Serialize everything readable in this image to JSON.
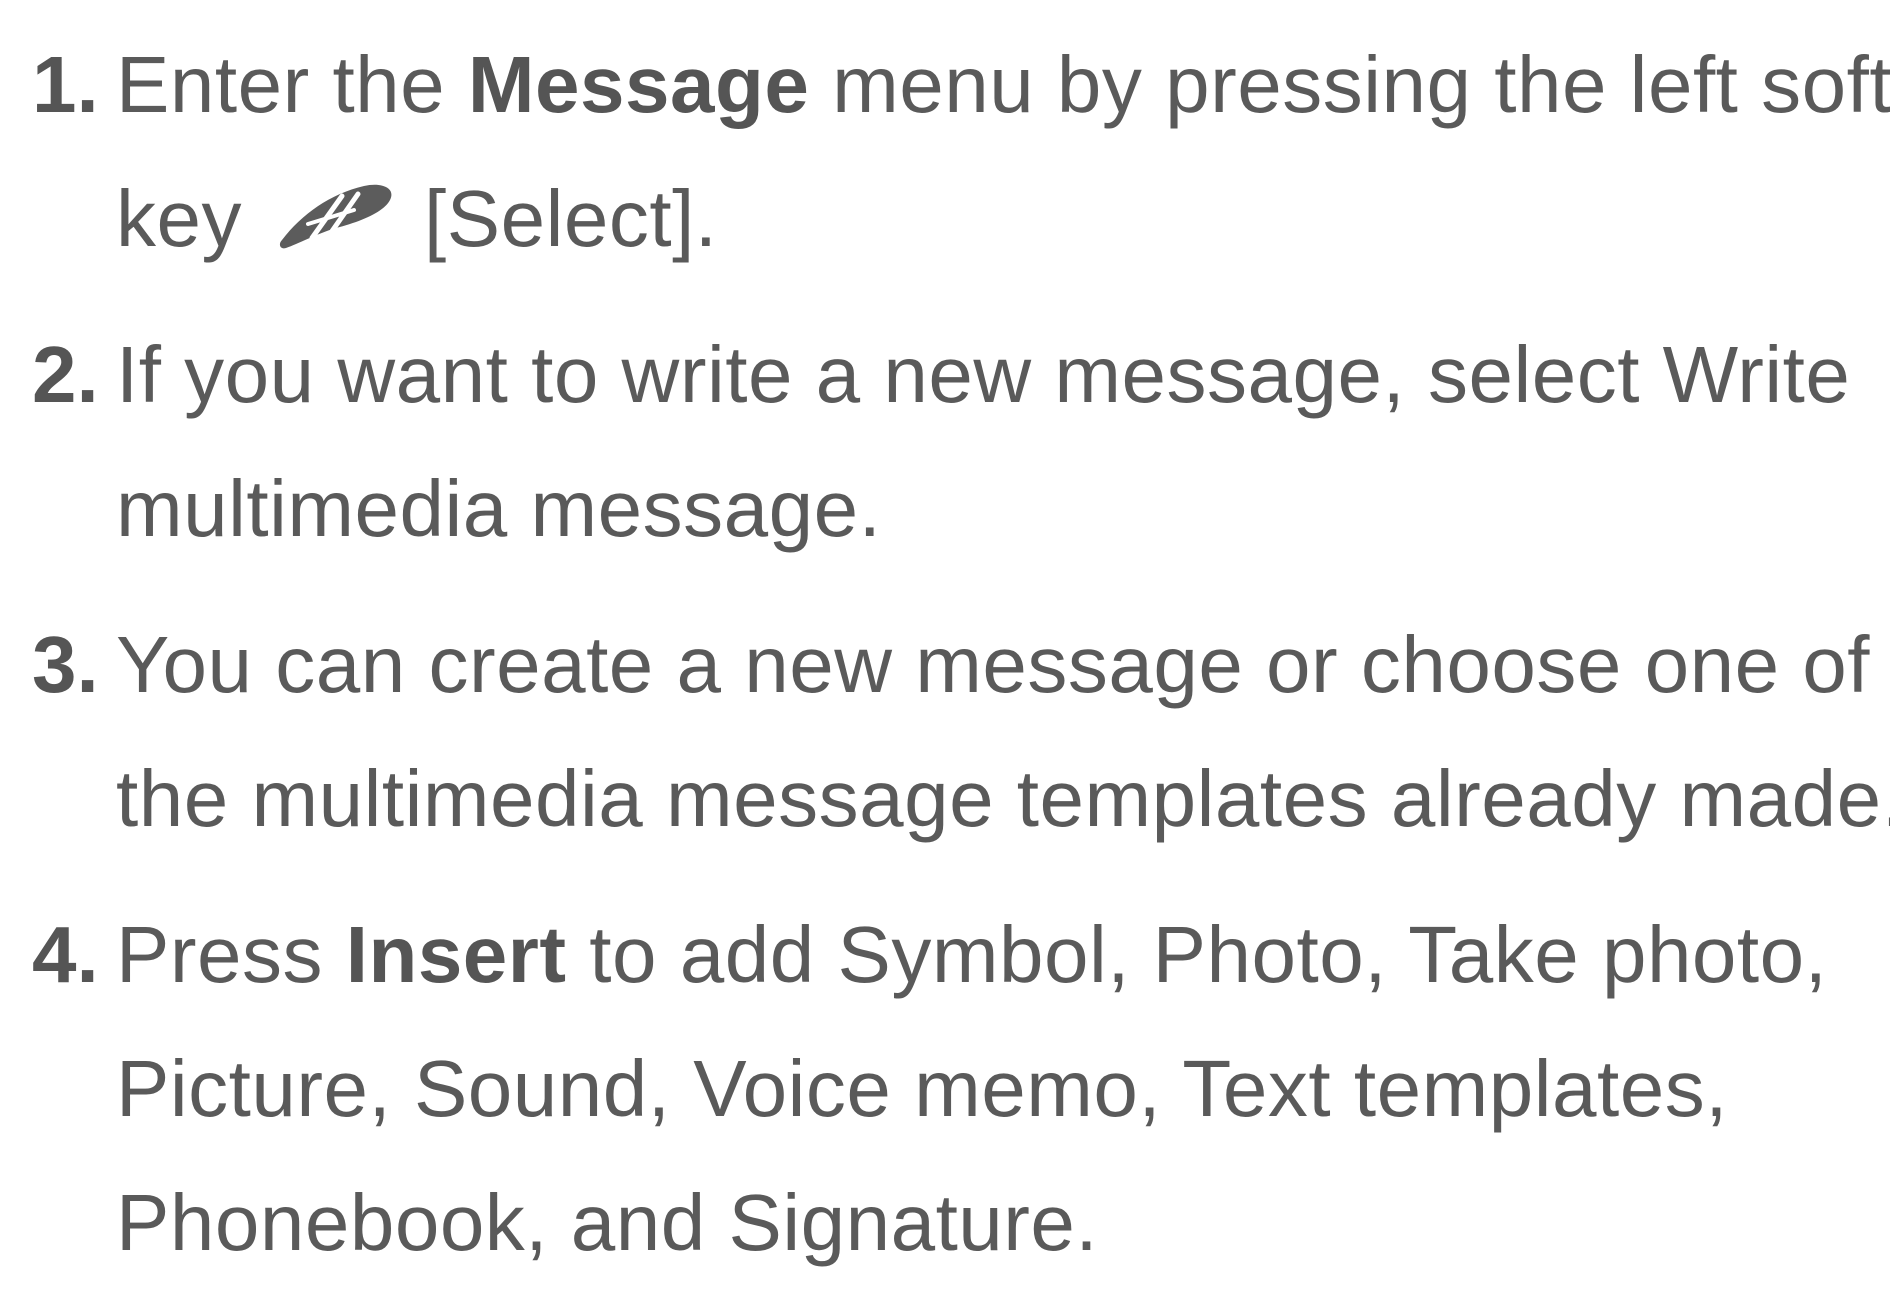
{
  "steps": [
    {
      "number": "1.",
      "line1": {
        "before": "Enter the ",
        "bold": "Message",
        "after": " menu by pressing the left soft"
      },
      "line2": {
        "before": "key",
        "after": "[Select]."
      },
      "icon": "left-soft-key-icon"
    },
    {
      "number": "2.",
      "lines": [
        "If you want to write a new message, select Write",
        "multimedia message."
      ]
    },
    {
      "number": "3.",
      "lines": [
        "You can create a new message or choose one of",
        "the multimedia message templates already made."
      ]
    },
    {
      "number": "4.",
      "line1": {
        "before": "Press ",
        "bold": "Insert",
        "after": " to add Symbol, Photo, Take photo,"
      },
      "lines": [
        "Picture, Sound, Voice memo, Text templates,",
        "Phonebook, and Signature."
      ]
    }
  ]
}
